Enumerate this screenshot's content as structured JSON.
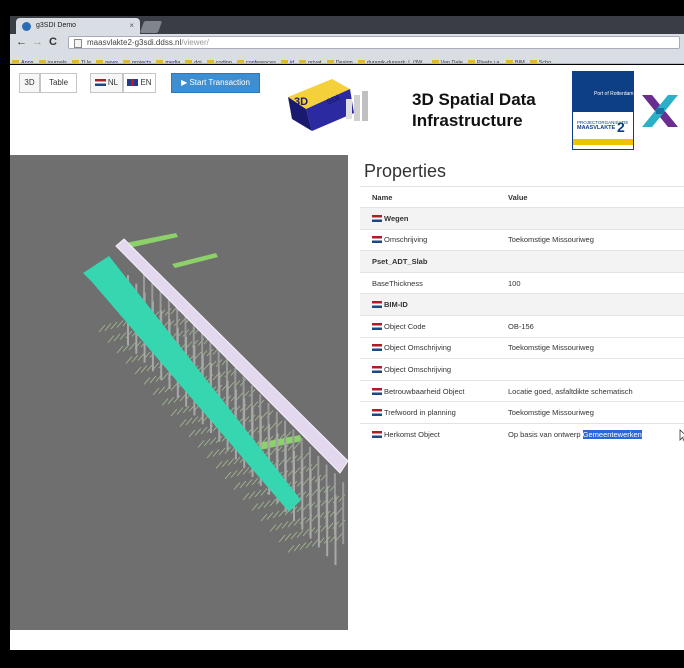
{
  "browser": {
    "tab_title": "g3SDI Demo",
    "tab_close": "×",
    "url_host": "maasvlakte2-g3sdi.ddss.nl",
    "url_path": "/viewer/",
    "bookmarks": [
      "Apps",
      "journals",
      "TUe",
      "news",
      "projects",
      "media",
      "doi",
      "coding",
      "conferences",
      "jd",
      "privat",
      "Design",
      "durasrk-durasrk: L.j3W...",
      "Van Dale",
      "Plaats.j.a.",
      "BIM",
      "Scho"
    ]
  },
  "toolbar": {
    "btn_3d": "3D",
    "btn_table": "Table",
    "btn_nl": "NL",
    "btn_en": "EN",
    "btn_start": "Start Transaction"
  },
  "header": {
    "logo_3d_text": "3D",
    "logo_sdi_text": "SDI",
    "title_line1": "3D Spatial Data",
    "title_line2": "Infrastructure",
    "port_logo_text": "Port of Rotterdam",
    "port_project": "PROJECTORGANISATIE",
    "port_maasvlakte": "MAASVLAKTE",
    "port_number": "2"
  },
  "properties": {
    "title": "Properties",
    "col_name": "Name",
    "col_value": "Value",
    "rows": [
      {
        "name": "Wegen",
        "value": "",
        "group": true,
        "flag": true
      },
      {
        "name": "Omschrijving",
        "value": "Toekomstige Missouriweg",
        "group": false,
        "flag": true
      },
      {
        "name": "Pset_ADT_Slab",
        "value": "",
        "group": true,
        "flag": false
      },
      {
        "name": "BaseThickness",
        "value": "100",
        "group": false,
        "flag": false
      },
      {
        "name": "BIM-ID",
        "value": "",
        "group": true,
        "flag": true
      },
      {
        "name": "Object Code",
        "value": "OB-156",
        "group": false,
        "flag": true
      },
      {
        "name": "Object Omschrijving",
        "value": "Toekomstige Missouriweg",
        "group": false,
        "flag": true
      },
      {
        "name": "Object Omschrijving",
        "value": "",
        "group": false,
        "flag": true
      },
      {
        "name": "Betrouwbaarheid Object",
        "value": "Locatie goed, asfaltdikte schematisch",
        "group": false,
        "flag": true
      },
      {
        "name": "Trefwoord in planning",
        "value": "Toekomstige Missouriweg",
        "group": false,
        "flag": true
      },
      {
        "name": "Herkomst Object",
        "value": "Op basis van ontwerp",
        "value_selected": "Gemeentewerken",
        "group": false,
        "flag": true
      }
    ]
  },
  "colors": {
    "viewer_bg": "#6f6f6f",
    "road_teal": "#35d6b0",
    "deck_lavender": "#e3d8ee",
    "pile_green": "#8fc46a",
    "primary_button": "#3d8fd1"
  }
}
